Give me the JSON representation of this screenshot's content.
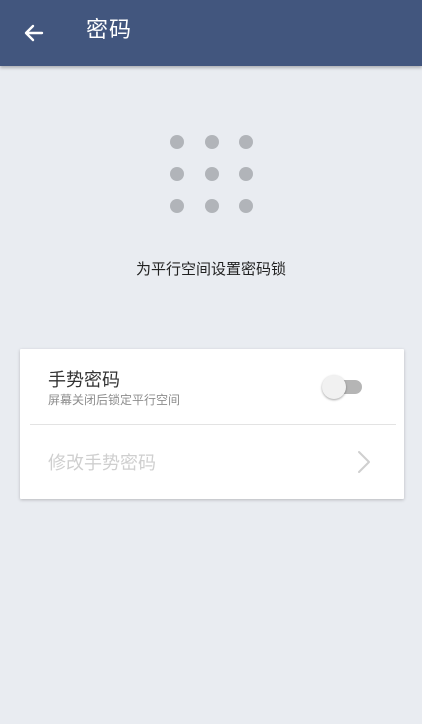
{
  "header": {
    "title": "密码",
    "back_icon": "arrow-left-icon",
    "background": "#42567e"
  },
  "hero": {
    "icon": "pattern-lock-icon",
    "description": "为平行空间设置密码锁"
  },
  "settings": {
    "gesture_password": {
      "title": "手势密码",
      "subtitle": "屏幕关闭后锁定平行空间",
      "enabled": false
    },
    "change_gesture_password": {
      "label": "修改手势密码",
      "disabled": true,
      "icon": "chevron-right-icon"
    }
  }
}
